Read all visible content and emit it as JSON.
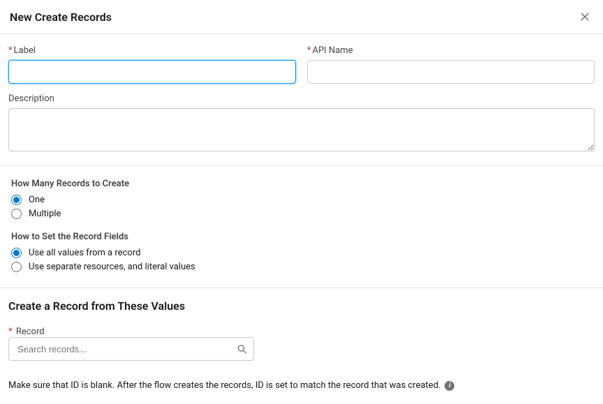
{
  "header": {
    "title": "New Create Records"
  },
  "fields": {
    "label": {
      "label": "Label",
      "value": ""
    },
    "apiName": {
      "label": "API Name",
      "value": ""
    },
    "description": {
      "label": "Description",
      "value": ""
    }
  },
  "radioGroups": {
    "howMany": {
      "legend": "How Many Records to Create",
      "options": {
        "one": "One",
        "multiple": "Multiple"
      }
    },
    "howToSet": {
      "legend": "How to Set the Record Fields",
      "options": {
        "allValues": "Use all values from a record",
        "separate": "Use separate resources, and literal values"
      }
    }
  },
  "createSection": {
    "heading": "Create a Record from These Values",
    "recordLabel": "Record",
    "recordPlaceholder": "Search records...",
    "helperText": "Make sure that ID is blank. After the flow creates the records, ID is set to match the record that was created."
  }
}
